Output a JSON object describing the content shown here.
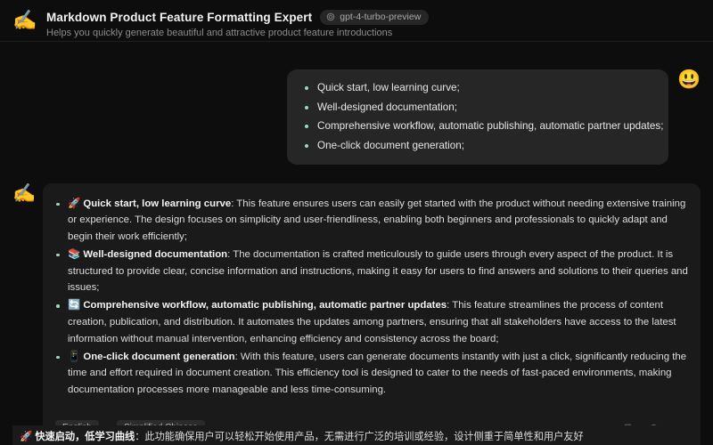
{
  "header": {
    "icon": "writing-hand-emoji",
    "icon_glyph": "✍️",
    "title": "Markdown Product Feature Formatting Expert",
    "model_badge": "gpt-4-turbo-preview",
    "subtitle": "Helps you quickly generate beautiful and attractive product feature introductions"
  },
  "user_message": {
    "avatar_glyph": "😃",
    "bullets": [
      "Quick start, low learning curve;",
      "Well-designed documentation;",
      "Comprehensive workflow, automatic publishing, automatic partner updates;",
      "One-click document generation;"
    ]
  },
  "assistant_message": {
    "avatar_glyph": "✍️",
    "bullets": [
      {
        "emoji": "🚀",
        "title": "Quick start, low learning curve",
        "body": ": This feature ensures users can easily get started with the product without needing extensive training or experience. The design focuses on simplicity and user-friendliness, enabling both beginners and professionals to quickly adapt and begin their work efficiently;"
      },
      {
        "emoji": "📚",
        "title": "Well-designed documentation",
        "body": ": The documentation is crafted meticulously to guide users through every aspect of the product. It is structured to provide clear, concise information and instructions, making it easy for users to find answers and solutions to their queries and issues;"
      },
      {
        "emoji": "🔄",
        "title": "Comprehensive workflow, automatic publishing, automatic partner updates",
        "body": ": This feature streamlines the process of content creation, publication, and distribution. It automates the updates among partners, ensuring that all stakeholders have access to the latest information without manual intervention, enhancing efficiency and consistency across the board;"
      },
      {
        "emoji": "📱",
        "title": "One-click document generation",
        "body": ": With this feature, users can generate documents instantly with just a click, significantly reducing the time and effort required in document creation. This efficiency tool is designed to cater to the needs of fast-paced environments, making documentation processes more manageable and less time-consuming."
      }
    ],
    "footer": {
      "source_language": "English",
      "arrow": "»",
      "target_language": "Simplified Chinese",
      "actions": [
        "copy-icon",
        "trash-icon",
        "chevron-down-icon"
      ]
    }
  },
  "translated_preview": {
    "emoji": "🚀",
    "title": "快速启动，低学习曲线",
    "body": "：此功能确保用户可以轻松开始使用产品，无需进行广泛的培训或经验，设计侧重于简单性和用户友好"
  },
  "colors": {
    "page_background": "#0d0d0d",
    "user_bubble": "#262626",
    "assistant_card": "#1a1a1a",
    "bullet_accent": "#9ad9b8",
    "primary_text": "#ececec",
    "muted_text": "#8c8c8c"
  }
}
